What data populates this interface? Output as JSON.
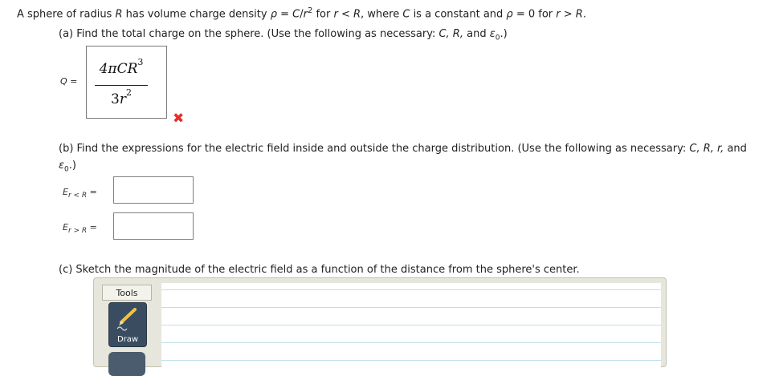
{
  "problem": {
    "statement_pre": "A sphere of radius ",
    "var_R": "R",
    "statement_mid1": " has volume charge density ",
    "rho": "ρ",
    "statement_mid2": " = ",
    "var_C": "C",
    "slash": "/",
    "var_r": "r",
    "sq": "2",
    "statement_mid3": " for ",
    "cond1": "r < R",
    "statement_mid4": ", where ",
    "var_C2": "C",
    "statement_mid5": " is a constant and ",
    "rho2": "ρ",
    "statement_mid6": " = 0 for ",
    "cond2": "r > R",
    "statement_end": "."
  },
  "part_a": {
    "text_pre": "(a) Find the total charge on the sphere. (Use the following as necessary: ",
    "vars": "C, R,",
    "text_and": " and ",
    "eps": "ε",
    "eps_sub": "0",
    "text_end": ".)",
    "answer_label": "Q =",
    "answer_numerator": "4πCR",
    "answer_numerator_exp": "3",
    "answer_denominator_coef": "3",
    "answer_denominator_var": "r",
    "answer_denominator_exp": "2",
    "incorrect_mark": "✖"
  },
  "part_b": {
    "text_line1": "(b) Find the expressions for the electric field inside and outside the charge distribution. (Use the following as necessary: ",
    "vars": "C, R, r,",
    "text_and": " and",
    "eps": "ε",
    "eps_sub": "0",
    "text_end": ".)",
    "field_inside_label": "E",
    "field_inside_sub": "r < R",
    "field_outside_label": "E",
    "field_outside_sub": "r > R",
    "equals": "=",
    "field_inside_value": "",
    "field_outside_value": ""
  },
  "part_c": {
    "text": "(c) Sketch the magnitude of the electric field as a function of the distance from the sphere's center.",
    "tools_label": "Tools",
    "draw_label": "Draw"
  },
  "colors": {
    "incorrect": "#e0312b",
    "tool_button": "#3a4d60",
    "grid_line": "#bfe0ee"
  }
}
